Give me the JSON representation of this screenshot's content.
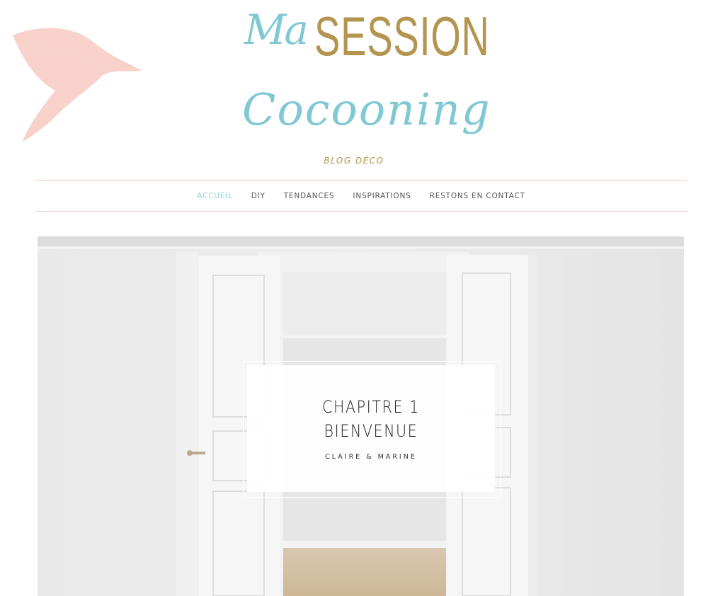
{
  "header": {
    "logo_ma": "Ma",
    "logo_session": "SESSION",
    "logo_cocooning": "Cocooning",
    "tagline": "BLOG DÉCO"
  },
  "nav": {
    "items": [
      {
        "label": "ACCUEIL",
        "active": true
      },
      {
        "label": "DIY",
        "active": false
      },
      {
        "label": "TENDANCES",
        "active": false
      },
      {
        "label": "INSPIRATIONS",
        "active": false
      },
      {
        "label": "RESTONS EN CONTACT",
        "active": false
      }
    ]
  },
  "hero": {
    "title_line1": "CHAPITRE 1",
    "title_line2": "BIENVENUE",
    "authors": "CLAIRE & MARINE"
  },
  "colors": {
    "accent_blue": "#7fc8d4",
    "accent_gold": "#b4954f",
    "divider_pink": "#f2c9c1"
  }
}
